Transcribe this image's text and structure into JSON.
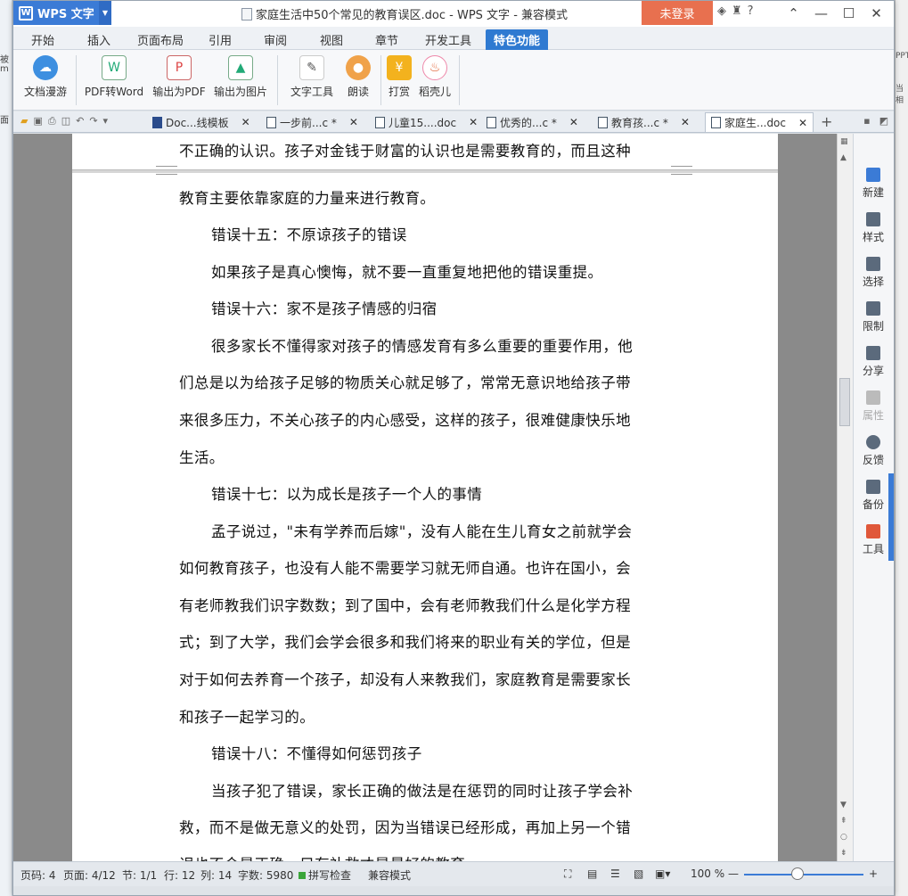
{
  "titlebar": {
    "app_name": "WPS 文字",
    "doc_title": "家庭生活中50个常见的教育误区.doc - WPS 文字 - 兼容模式",
    "login": "未登录"
  },
  "menu": {
    "tabs": [
      "开始",
      "插入",
      "页面布局",
      "引用",
      "审阅",
      "视图",
      "章节",
      "开发工具",
      "特色功能"
    ],
    "active": "特色功能"
  },
  "ribbon": {
    "items": [
      "文档漫游",
      "PDF转Word",
      "输出为PDF",
      "输出为图片",
      "文字工具",
      "朗读",
      "打赏",
      "稻壳儿"
    ]
  },
  "doc_tabs": [
    {
      "label": "Doc...线模板"
    },
    {
      "label": "一步前...c *"
    },
    {
      "label": "儿童15....doc"
    },
    {
      "label": "优秀的...c *"
    },
    {
      "label": "教育孩...c *"
    },
    {
      "label": "家庭生...doc"
    }
  ],
  "content": {
    "lines": [
      "不正确的认识。孩子对金钱于财富的认识也是需要教育的，而且这种",
      "教育主要依靠家庭的力量来进行教育。",
      "错误十五：不原谅孩子的错误",
      "如果孩子是真心懊悔，就不要一直重复地把他的错误重提。",
      "错误十六：家不是孩子情感的归宿",
      "很多家长不懂得家对孩子的情感发育有多么重要的重要作用，他",
      "们总是以为给孩子足够的物质关心就足够了，常常无意识地给孩子带",
      "来很多压力，不关心孩子的内心感受，这样的孩子，很难健康快乐地",
      "生活。",
      "错误十七：以为成长是孩子一个人的事情",
      "孟子说过，\"未有学养而后嫁\"，没有人能在生儿育女之前就学会",
      "如何教育孩子，也没有人能不需要学习就无师自通。也许在国小，会",
      "有老师教我们识字数数；到了国中，会有老师教我们什么是化学方程",
      "式；到了大学，我们会学会很多和我们将来的职业有关的学位，但是",
      "对于如何去养育一个孩子，却没有人来教我们，家庭教育是需要家长",
      "和孩子一起学习的。",
      "错误十八：不懂得如何惩罚孩子",
      "当孩子犯了错误，家长正确的做法是在惩罚的同时让孩子学会补",
      "救，而不是做无意义的处罚，因为当错误已经形成，再加上另一个错",
      "误也不会是正确，只有补救才是最好的教育。"
    ]
  },
  "right_panel": [
    "新建",
    "样式",
    "选择",
    "限制",
    "分享",
    "属性",
    "反馈",
    "备份",
    "工具"
  ],
  "status": {
    "page_code": "页码: 4",
    "pages": "页面: 4/12",
    "section": "节: 1/1",
    "row": "行: 12",
    "col": "列: 14",
    "word_count": "字数: 5980",
    "spell": "拼写检查",
    "mode": "兼容模式",
    "zoom": "100 %",
    "zoom_level": 0.45
  },
  "bg": {
    "left_labels": [
      "被",
      "面",
      "m"
    ],
    "right_labels": [
      "PPT",
      "当相"
    ]
  }
}
